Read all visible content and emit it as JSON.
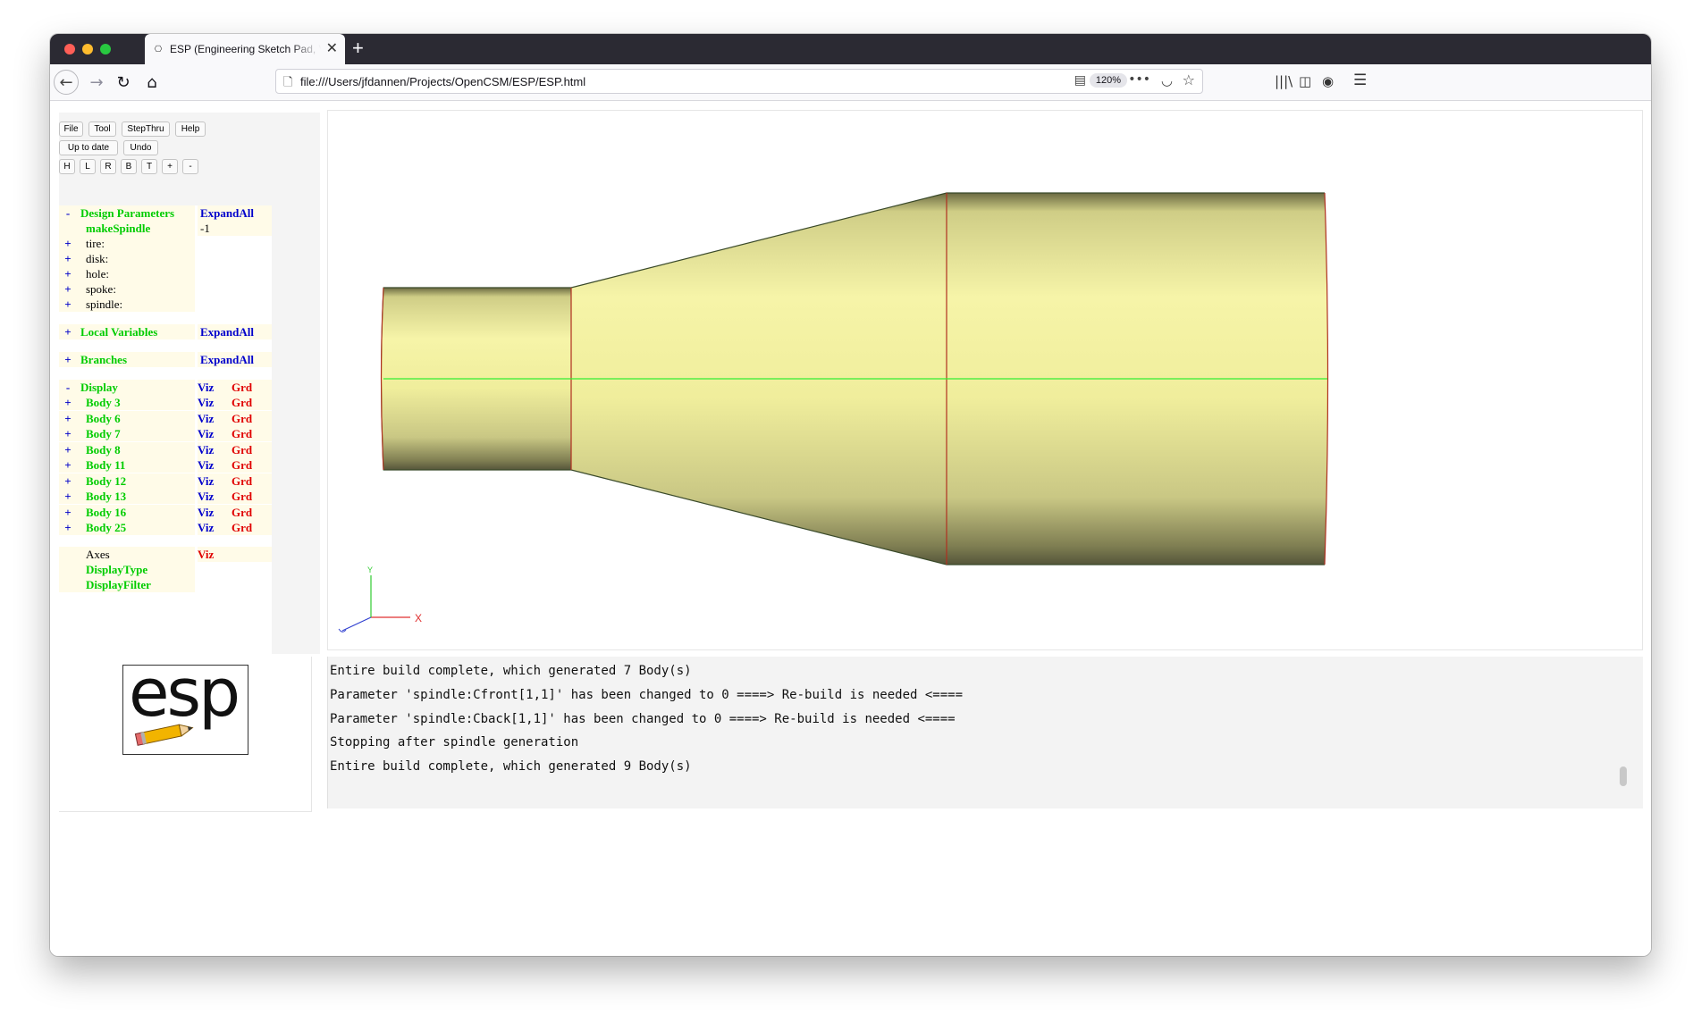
{
  "browser": {
    "tab_title": "ESP (Engineering Sketch Pad, V",
    "tab_favicon": "esp",
    "url": "file:///Users/jfdannen/Projects/OpenCSM/ESP/ESP.html",
    "zoom": "120%"
  },
  "toolbar": {
    "row1": [
      "File",
      "Tool",
      "StepThru",
      "Help"
    ],
    "row2": [
      "Up to date",
      "Undo"
    ],
    "row3": [
      "H",
      "L",
      "R",
      "B",
      "T",
      "+",
      "-"
    ]
  },
  "tree": {
    "design_params": {
      "sign": "-",
      "label": "Design Parameters",
      "action": "ExpandAll"
    },
    "make_spindle": {
      "label": "makeSpindle",
      "value": "-1"
    },
    "param_groups": [
      {
        "sign": "+",
        "label": "tire:"
      },
      {
        "sign": "+",
        "label": "disk:"
      },
      {
        "sign": "+",
        "label": "hole:"
      },
      {
        "sign": "+",
        "label": "spoke:"
      },
      {
        "sign": "+",
        "label": "spindle:"
      }
    ],
    "local_vars": {
      "sign": "+",
      "label": "Local Variables",
      "action": "ExpandAll"
    },
    "branches": {
      "sign": "+",
      "label": "Branches",
      "action": "ExpandAll"
    },
    "display": {
      "sign": "-",
      "label": "Display",
      "viz": "Viz",
      "grd": "Grd"
    },
    "bodies": [
      {
        "sign": "+",
        "label": "Body 3",
        "viz": "Viz",
        "grd": "Grd"
      },
      {
        "sign": "+",
        "label": "Body 6",
        "viz": "Viz",
        "grd": "Grd"
      },
      {
        "sign": "+",
        "label": "Body 7",
        "viz": "Viz",
        "grd": "Grd"
      },
      {
        "sign": "+",
        "label": "Body 8",
        "viz": "Viz",
        "grd": "Grd"
      },
      {
        "sign": "+",
        "label": "Body 11",
        "viz": "Viz",
        "grd": "Grd"
      },
      {
        "sign": "+",
        "label": "Body 12",
        "viz": "Viz",
        "grd": "Grd"
      },
      {
        "sign": "+",
        "label": "Body 13",
        "viz": "Viz",
        "grd": "Grd"
      },
      {
        "sign": "+",
        "label": "Body 16",
        "viz": "Viz",
        "grd": "Grd"
      },
      {
        "sign": "+",
        "label": "Body 25",
        "viz": "Viz",
        "grd": "Grd"
      }
    ],
    "axes": {
      "label": "Axes",
      "viz": "Viz"
    },
    "display_type": "DisplayType",
    "display_filter": "DisplayFilter"
  },
  "logo": {
    "text": "esp"
  },
  "viewer": {
    "axis_x_label": "X",
    "axis_y_label": "Y",
    "surface_color": "#f0ee9a",
    "edge_color": "#b03020",
    "axis_line_color": "#22ee22"
  },
  "console": [
    "Entire build complete, which generated 7 Body(s)",
    "Parameter 'spindle:Cfront[1,1]' has been changed to 0 ====> Re-build is needed <====",
    "Parameter 'spindle:Cback[1,1]' has been changed to 0 ====> Re-build is needed <====",
    "Stopping after spindle generation",
    "Entire build complete, which generated 9 Body(s)"
  ]
}
